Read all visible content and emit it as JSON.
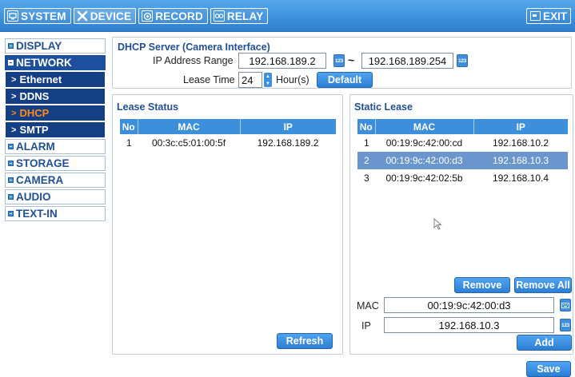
{
  "topbar": {
    "tabs": [
      {
        "label": "SYSTEM",
        "icon": "monitor-icon",
        "active": false
      },
      {
        "label": "DEVICE",
        "icon": "tools-icon",
        "active": true
      },
      {
        "label": "RECORD",
        "icon": "record-icon",
        "active": false
      },
      {
        "label": "RELAY",
        "icon": "relay-icon",
        "active": false
      }
    ],
    "exit_label": "EXIT"
  },
  "sidebar": {
    "items": [
      {
        "label": "DISPLAY"
      },
      {
        "label": "NETWORK",
        "expanded": true,
        "children": [
          {
            "label": "Ethernet"
          },
          {
            "label": "DDNS"
          },
          {
            "label": "DHCP",
            "active": true
          },
          {
            "label": "SMTP"
          }
        ]
      },
      {
        "label": "ALARM"
      },
      {
        "label": "STORAGE"
      },
      {
        "label": "CAMERA"
      },
      {
        "label": "AUDIO"
      },
      {
        "label": "TEXT-IN"
      }
    ]
  },
  "dhcp_server": {
    "title": "DHCP Server (Camera Interface)",
    "ip_range_label": "IP Address Range",
    "ip_start": "192.168.189.2",
    "ip_end": "192.168.189.254",
    "range_separator": "~",
    "lease_time_label": "Lease Time",
    "lease_time_value": "24",
    "lease_unit": "Hour(s)",
    "default_label": "Default",
    "keyboard_badge": "123"
  },
  "lease_status": {
    "title": "Lease Status",
    "columns": [
      "No",
      "MAC",
      "IP"
    ],
    "rows": [
      {
        "no": "1",
        "mac": "00:3c:c5:01:00:5f",
        "ip": "192.168.189.2"
      }
    ],
    "refresh_label": "Refresh"
  },
  "static_lease": {
    "title": "Static Lease",
    "columns": [
      "No",
      "MAC",
      "IP"
    ],
    "rows": [
      {
        "no": "1",
        "mac": "00:19:9c:42:00:cd",
        "ip": "192.168.10.2"
      },
      {
        "no": "2",
        "mac": "00:19:9c:42:00:d3",
        "ip": "192.168.10.3",
        "selected": true
      },
      {
        "no": "3",
        "mac": "00:19:9c:42:02:5b",
        "ip": "192.168.10.4"
      }
    ],
    "remove_label": "Remove",
    "remove_all_label": "Remove All",
    "mac_label": "MAC",
    "mac_value": "00:19:9c:42:00:d3",
    "ip_label": "IP",
    "ip_value": "192.168.10.3",
    "add_label": "Add",
    "keyboard_badge": "123"
  },
  "save_label": "Save",
  "colors": {
    "topbar": "#3d8fdc",
    "nav_dark": "#143f85",
    "nav_active_text": "#ff8a1a",
    "header": "#3d8fdc",
    "selected_row": "#6b96cd",
    "title_text": "#1f4f98"
  }
}
